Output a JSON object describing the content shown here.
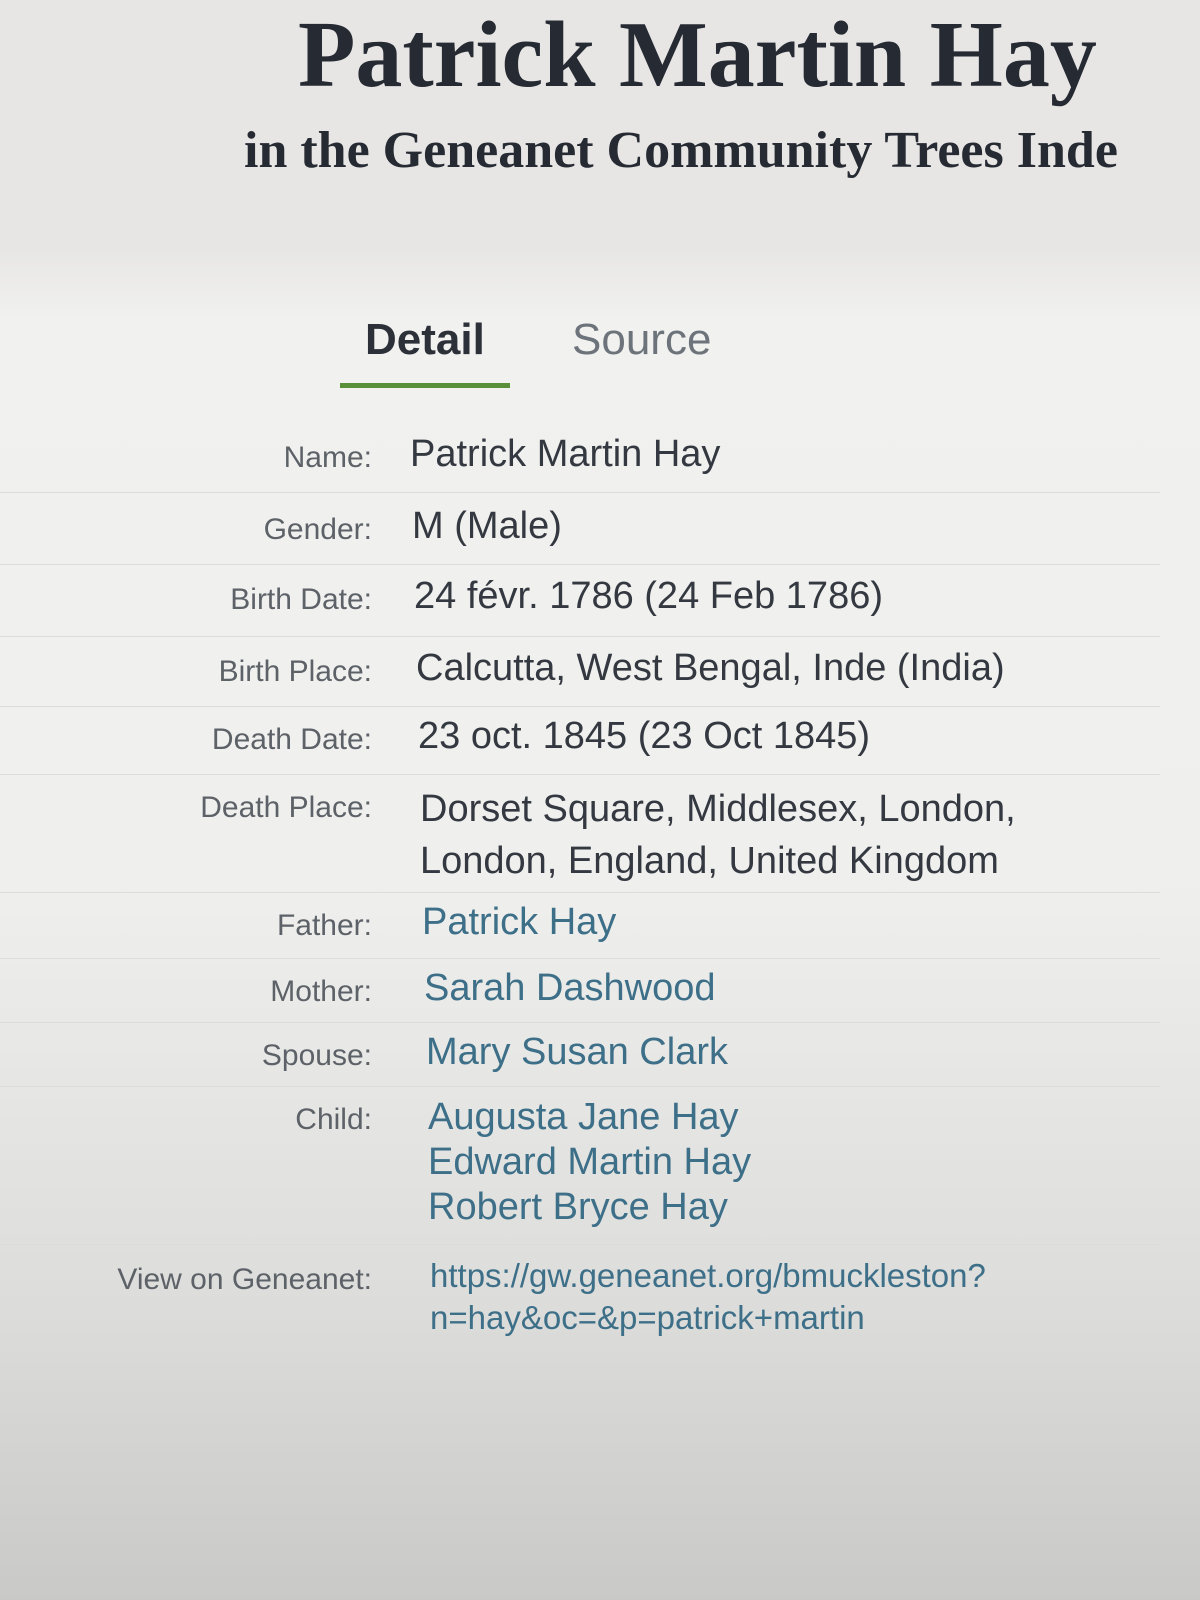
{
  "header": {
    "title": "Patrick Martin Hay",
    "subtitle": "in the Geneanet Community Trees Inde"
  },
  "tabs": [
    {
      "label": "Detail",
      "active": true
    },
    {
      "label": "Source",
      "active": false
    }
  ],
  "details": {
    "name": {
      "label": "Name:",
      "value": "Patrick Martin Hay"
    },
    "gender": {
      "label": "Gender:",
      "value": "M (Male)"
    },
    "birth_date": {
      "label": "Birth Date:",
      "value": "24 févr. 1786 (24 Feb 1786)"
    },
    "birth_place": {
      "label": "Birth Place:",
      "value": "Calcutta, West Bengal, Inde (India)"
    },
    "death_date": {
      "label": "Death Date:",
      "value": "23 oct. 1845 (23 Oct 1845)"
    },
    "death_place": {
      "label": "Death Place:",
      "lines": [
        "Dorset Square, Middlesex, London,",
        "London, England, United Kingdom"
      ]
    },
    "father": {
      "label": "Father:",
      "value": "Patrick Hay"
    },
    "mother": {
      "label": "Mother:",
      "value": "Sarah Dashwood"
    },
    "spouse": {
      "label": "Spouse:",
      "value": "Mary Susan Clark"
    },
    "child": {
      "label": "Child:",
      "values": [
        "Augusta Jane Hay",
        "Edward Martin Hay",
        "Robert Bryce Hay"
      ]
    },
    "view_on_geneanet": {
      "label": "View on Geneanet:",
      "lines": [
        "https://gw.geneanet.org/bmuckleston?",
        "n=hay&oc=&p=patrick+martin"
      ]
    }
  },
  "colors": {
    "link": "#3d6f88",
    "tab_underline": "#5a8f3a",
    "title_text": "#262a33"
  }
}
